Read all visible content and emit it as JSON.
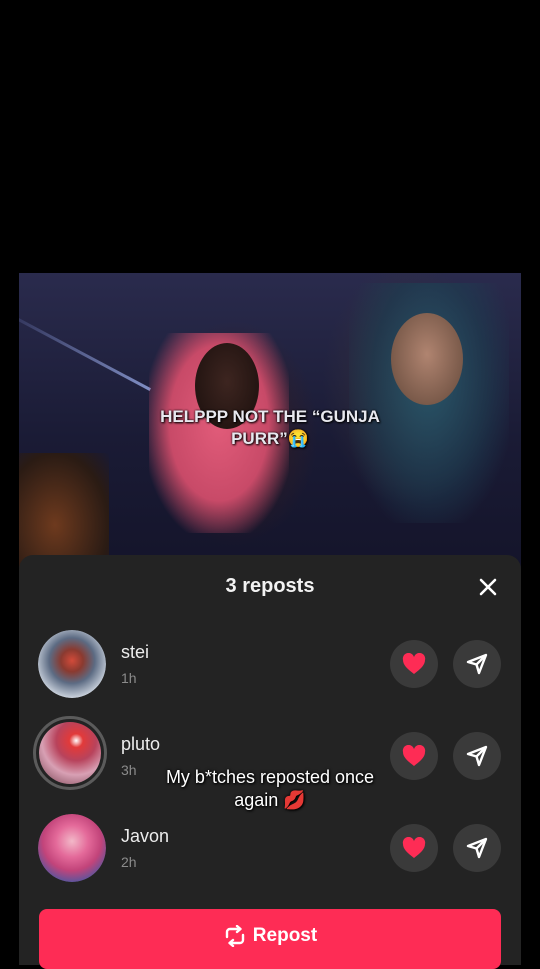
{
  "video": {
    "caption": "HELPPP NOT THE “GUNJA PURR”😭"
  },
  "sheet": {
    "title": "3 reposts",
    "reposters": [
      {
        "name": "stei",
        "time": "1h"
      },
      {
        "name": "pluto",
        "time": "3h"
      },
      {
        "name": "Javon",
        "time": "2h"
      }
    ]
  },
  "overlay": {
    "line1": "My b*tches reposted once",
    "line2": "again 💋"
  },
  "repost_button": {
    "label": "Repost"
  },
  "icons": {
    "close": "close-icon",
    "heart": "heart-icon",
    "send": "send-icon",
    "repost": "repost-icon"
  },
  "colors": {
    "accent": "#fe2c55",
    "sheet_bg": "#232323",
    "heart": "#fe2c55"
  }
}
